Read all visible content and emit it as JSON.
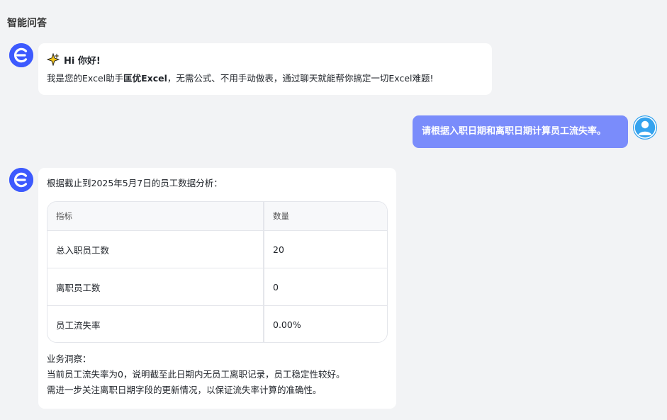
{
  "header": {
    "title": "智能问答"
  },
  "greeting": {
    "line1": "Hi 你好!",
    "line2_prefix": "我是您的Excel助手",
    "line2_brand": "匡优Excel",
    "line2_suffix": "，无需公式、不用手动做表，通过聊天就能帮你搞定一切Excel难题!"
  },
  "user_message": {
    "text": "请根据入职日期和离职日期计算员工流失率。"
  },
  "answer": {
    "intro": "根据截止到2025年5月7日的员工数据分析：",
    "table": {
      "headers": [
        "指标",
        "数量"
      ],
      "rows": [
        [
          "总入职员工数",
          "20"
        ],
        [
          "离职员工数",
          "0"
        ],
        [
          "员工流失率",
          "0.00%"
        ]
      ]
    },
    "insight_title": "业务洞察：",
    "insight_lines": [
      "当前员工流失率为0，说明截至此日期内无员工离职记录，员工稳定性较好。",
      "需进一步关注离职日期字段的更新情况，以保证流失率计算的准确性。"
    ]
  },
  "colors": {
    "bot_avatar": "#3d5afe",
    "user_bubble": "#7a8cfb",
    "user_avatar": "#35a3ee",
    "background": "#f2f3f5"
  },
  "icons": {
    "bot_avatar": "bot-logo-icon",
    "user_avatar": "user-person-icon",
    "greeting": "sparkle-icon"
  }
}
